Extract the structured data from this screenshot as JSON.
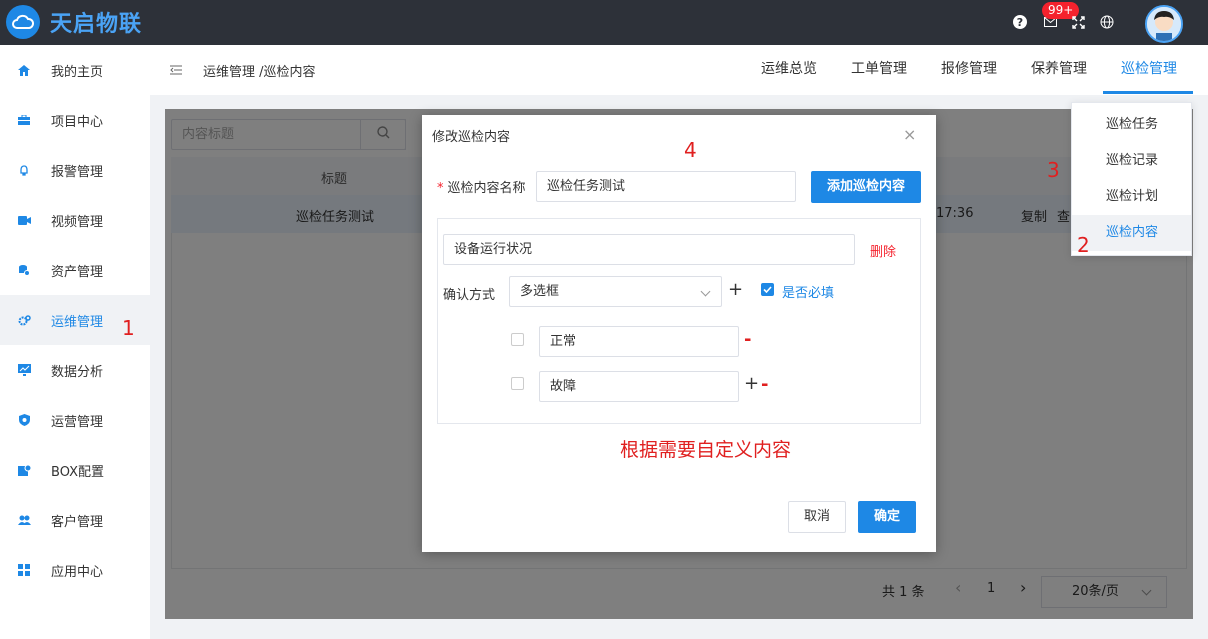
{
  "app": {
    "logo_text": "天启物联"
  },
  "topbar": {
    "help_glyph": "?",
    "mail_badge": "99+"
  },
  "sidebar": {
    "items": [
      {
        "label": "我的主页",
        "icon": "home-icon"
      },
      {
        "label": "项目中心",
        "icon": "briefcase-icon"
      },
      {
        "label": "报警管理",
        "icon": "bell-icon"
      },
      {
        "label": "视频管理",
        "icon": "video-icon"
      },
      {
        "label": "资产管理",
        "icon": "asset-icon"
      },
      {
        "label": "运维管理",
        "icon": "gear-icon"
      },
      {
        "label": "数据分析",
        "icon": "monitor-icon"
      },
      {
        "label": "运营管理",
        "icon": "shield-icon"
      },
      {
        "label": "BOX配置",
        "icon": "box-icon"
      },
      {
        "label": "客户管理",
        "icon": "users-icon"
      },
      {
        "label": "应用中心",
        "icon": "apps-icon"
      }
    ],
    "active_index": 5
  },
  "header": {
    "breadcrumb": "运维管理 /巡检内容",
    "tabs": [
      "运维总览",
      "工单管理",
      "报修管理",
      "保养管理",
      "巡检管理"
    ],
    "active_tab": "巡检管理"
  },
  "dropdown": {
    "items": [
      "巡检任务",
      "巡检记录",
      "巡检计划",
      "巡检内容"
    ],
    "active_item": "巡检内容"
  },
  "list": {
    "search_placeholder": "内容标题",
    "column_title": "标题",
    "row": {
      "title": "巡检任务测试",
      "time_fragment": "17:36",
      "action_copy": "复制",
      "action_view_fragment": "查"
    },
    "pagination": {
      "total": "共 1 条",
      "prev": "‹",
      "current_page": "1",
      "next": "›",
      "page_size": "20条/页"
    }
  },
  "modal": {
    "title": "修改巡检内容",
    "close_glyph": "×",
    "name_label": "巡检内容名称",
    "required_mark": "*",
    "name_value": "巡检任务测试",
    "add_button": "添加巡检内容",
    "item": {
      "name_value": "设备运行状况",
      "delete_label": "删除",
      "confirm_label": "确认方式",
      "confirm_value": "多选框",
      "required_label": "是否必填",
      "required_checked": true,
      "options": [
        {
          "value": "正常",
          "checked": false
        },
        {
          "value": "故障",
          "checked": false
        }
      ],
      "plus_glyph": "+",
      "minus_glyph": "-"
    },
    "cancel_button": "取消",
    "ok_button": "确定"
  },
  "annotations": {
    "step1": "1",
    "step2": "2",
    "step3": "3",
    "step4": "4",
    "note": "根据需要自定义内容",
    "color": "#e02020"
  },
  "colors": {
    "accent": "#1e88e5",
    "topbar": "#2d3139",
    "danger": "#f5222d"
  }
}
